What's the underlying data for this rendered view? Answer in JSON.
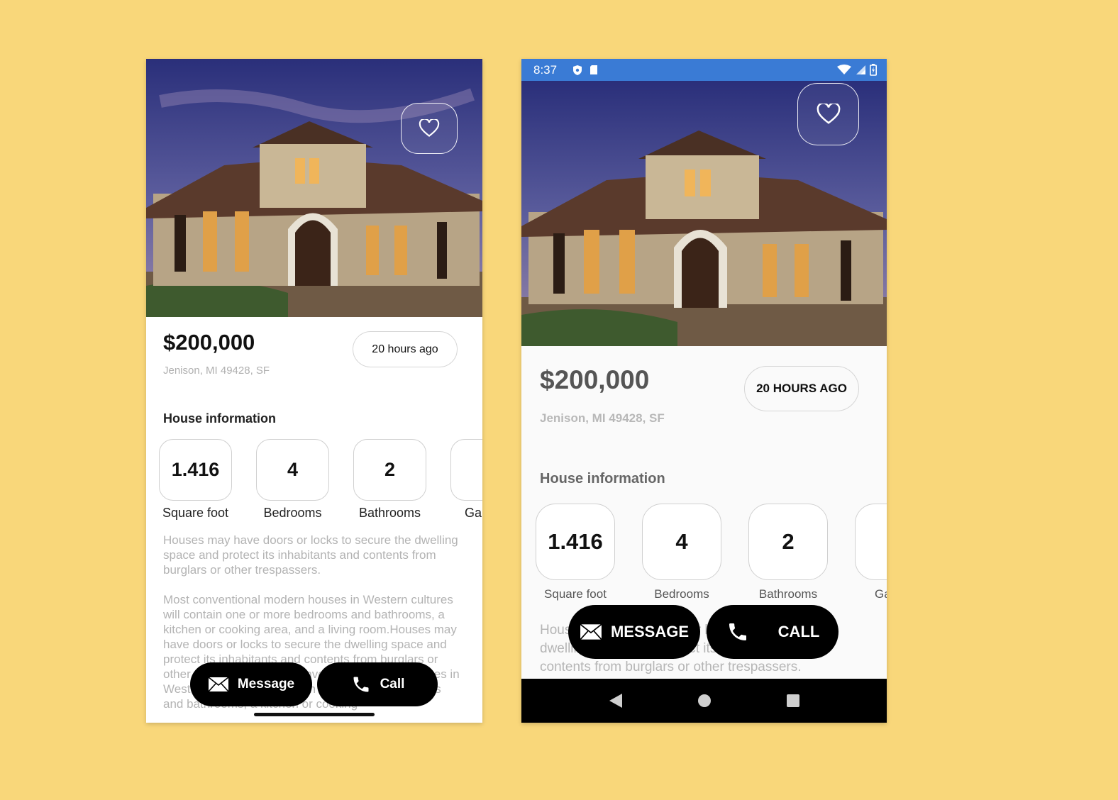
{
  "ios": {
    "price": "$200,000",
    "location": "Jenison, MI 49428, SF",
    "posted": "20 hours ago",
    "section_title": "House information",
    "stats": [
      {
        "value": "1.416",
        "label": "Square foot"
      },
      {
        "value": "4",
        "label": "Bedrooms"
      },
      {
        "value": "2",
        "label": "Bathrooms"
      },
      {
        "value": "",
        "label": "Ga"
      }
    ],
    "desc1": "Houses may have doors or locks to secure the dwelling space and protect its inhabitants and contents from burglars or other trespassers.",
    "desc2": "Most conventional modern houses in Western cultures will contain one or more bedrooms and bathrooms, a kitchen or cooking area, and a living room.Houses may have doors or locks to secure the dwelling space and protect its inhabitants and contents from burglars or other trespassers. Most conventional modern houses in Western cultures will contain one or more bedrooms and bathrooms, a kitchen or cooking",
    "message_label": "Message",
    "call_label": "Call"
  },
  "android": {
    "status_time": "8:37",
    "price": "$200,000",
    "location": "Jenison, MI 49428, SF",
    "posted": "20 HOURS AGO",
    "section_title": "House information",
    "stats": [
      {
        "value": "1.416",
        "label": "Square foot"
      },
      {
        "value": "4",
        "label": "Bedrooms"
      },
      {
        "value": "2",
        "label": "Bathrooms"
      },
      {
        "value": "",
        "label": "Ga"
      }
    ],
    "desc": "Houses may have doors or locks to secure the dwelling space and protect its inhabitants and contents from burglars or other trespassers.",
    "message_label": "MESSAGE",
    "call_label": "CALL"
  },
  "icons": {
    "favorite": "heart-icon",
    "message": "envelope-icon",
    "call": "phone-icon",
    "back": "triangle-back-icon",
    "home": "circle-home-icon",
    "recents": "square-recents-icon"
  },
  "colors": {
    "background": "#f9d77a",
    "button": "#000000",
    "android_statusbar": "#3a7bd5"
  }
}
